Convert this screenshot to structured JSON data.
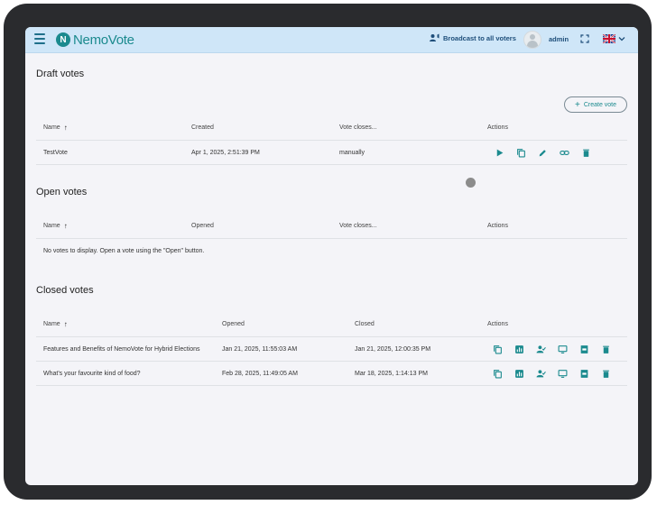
{
  "app": {
    "brand_letter": "N",
    "brand_name": "NemoVote",
    "broadcast_label": "Broadcast to all voters",
    "username": "admin"
  },
  "colors": {
    "accent": "#1b8a8e",
    "topbar_bg": "#cfe6f8",
    "page_bg": "#f4f4f8"
  },
  "draft": {
    "title": "Draft votes",
    "create_label": "Create vote",
    "columns": [
      "Name",
      "Created",
      "Vote closes...",
      "Actions"
    ],
    "rows": [
      {
        "name": "TestVote",
        "created": "Apr 1, 2025, 2:51:39 PM",
        "closes": "manually"
      }
    ],
    "row_action_icons": [
      "play-icon",
      "copy-icon",
      "edit-icon",
      "link-icon",
      "delete-icon"
    ]
  },
  "open": {
    "title": "Open votes",
    "columns": [
      "Name",
      "Opened",
      "Vote closes...",
      "Actions"
    ],
    "empty_message": "No votes to display. Open a vote using the \"Open\" button."
  },
  "closed": {
    "title": "Closed votes",
    "columns": [
      "Name",
      "Opened",
      "Closed",
      "Actions"
    ],
    "rows": [
      {
        "name": "Features and Benefits of NemoVote for Hybrid Elections",
        "opened": "Jan 21, 2025, 11:55:03 AM",
        "closed": "Jan 21, 2025, 12:00:35 PM"
      },
      {
        "name": "What's your favourite kind of food?",
        "opened": "Feb 28, 2025, 11:49:05 AM",
        "closed": "Mar 18, 2025, 1:14:13 PM"
      }
    ],
    "row_action_icons": [
      "copy-icon",
      "bar-chart-icon",
      "voters-icon",
      "monitor-icon",
      "pdf-icon",
      "delete-icon"
    ]
  }
}
